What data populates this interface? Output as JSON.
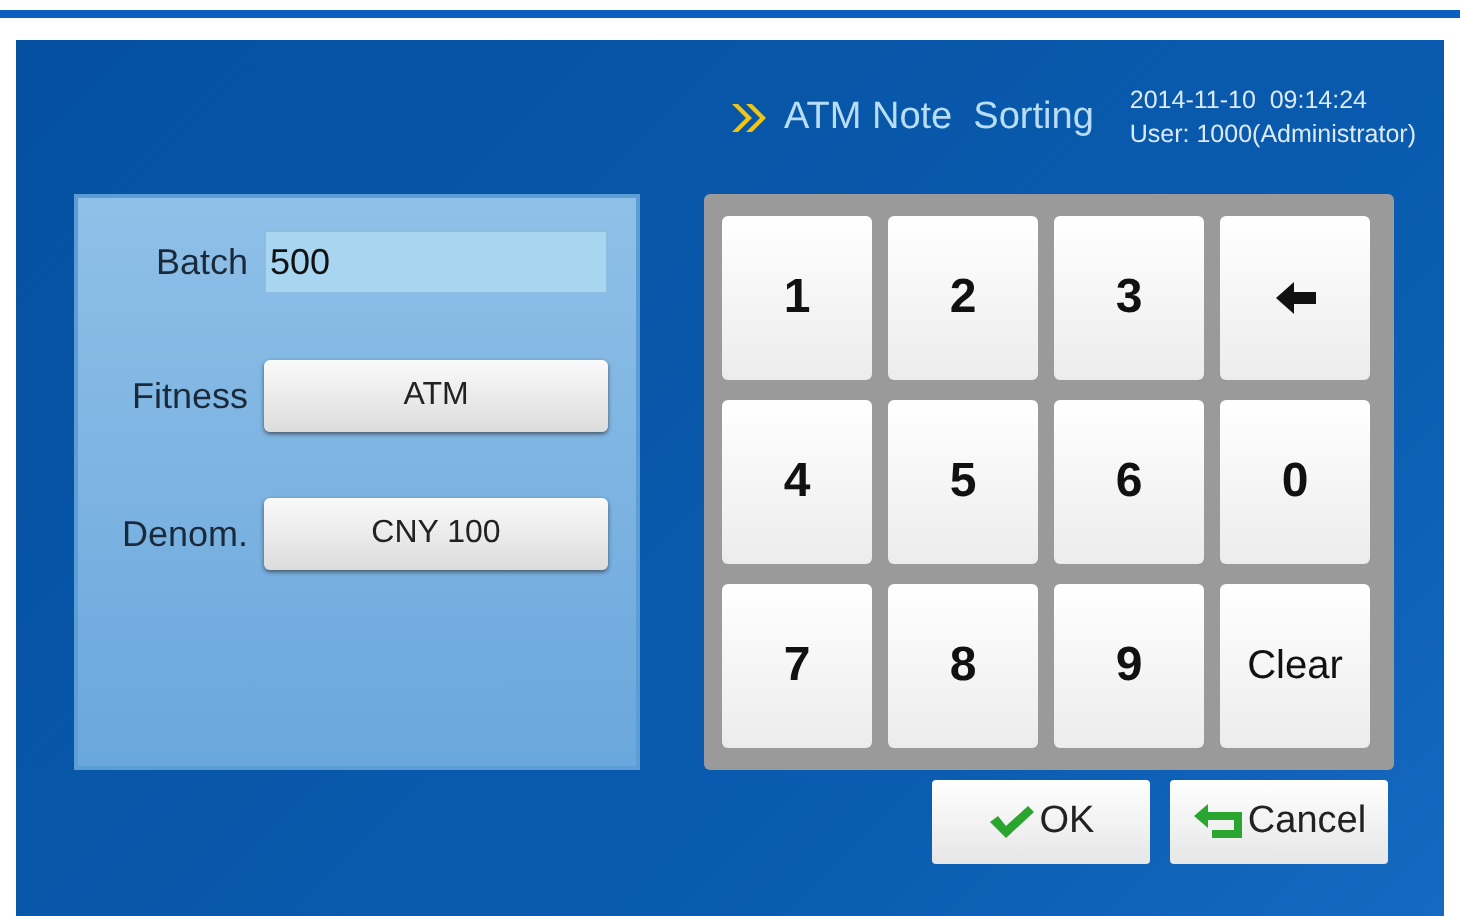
{
  "header": {
    "title": "ATM Note  Sorting",
    "datetime": "2014-11-10  09:14:24",
    "user": "User: 1000(Administrator)"
  },
  "form": {
    "batch": {
      "label": "Batch",
      "value": "500"
    },
    "rows": [
      {
        "label": "Fitness",
        "value": "ATM"
      },
      {
        "label": "Denom.",
        "value": "CNY 100"
      }
    ]
  },
  "keypad": [
    {
      "kind": "digit",
      "label": "1"
    },
    {
      "kind": "digit",
      "label": "2"
    },
    {
      "kind": "digit",
      "label": "3"
    },
    {
      "kind": "backspace"
    },
    {
      "kind": "digit",
      "label": "4"
    },
    {
      "kind": "digit",
      "label": "5"
    },
    {
      "kind": "digit",
      "label": "6"
    },
    {
      "kind": "digit",
      "label": "0"
    },
    {
      "kind": "digit",
      "label": "7"
    },
    {
      "kind": "digit",
      "label": "8"
    },
    {
      "kind": "digit",
      "label": "9"
    },
    {
      "kind": "clear",
      "label": "Clear"
    }
  ],
  "buttons": [
    {
      "kind": "ok",
      "label": "OK"
    },
    {
      "kind": "cancel",
      "label": "Cancel"
    }
  ]
}
